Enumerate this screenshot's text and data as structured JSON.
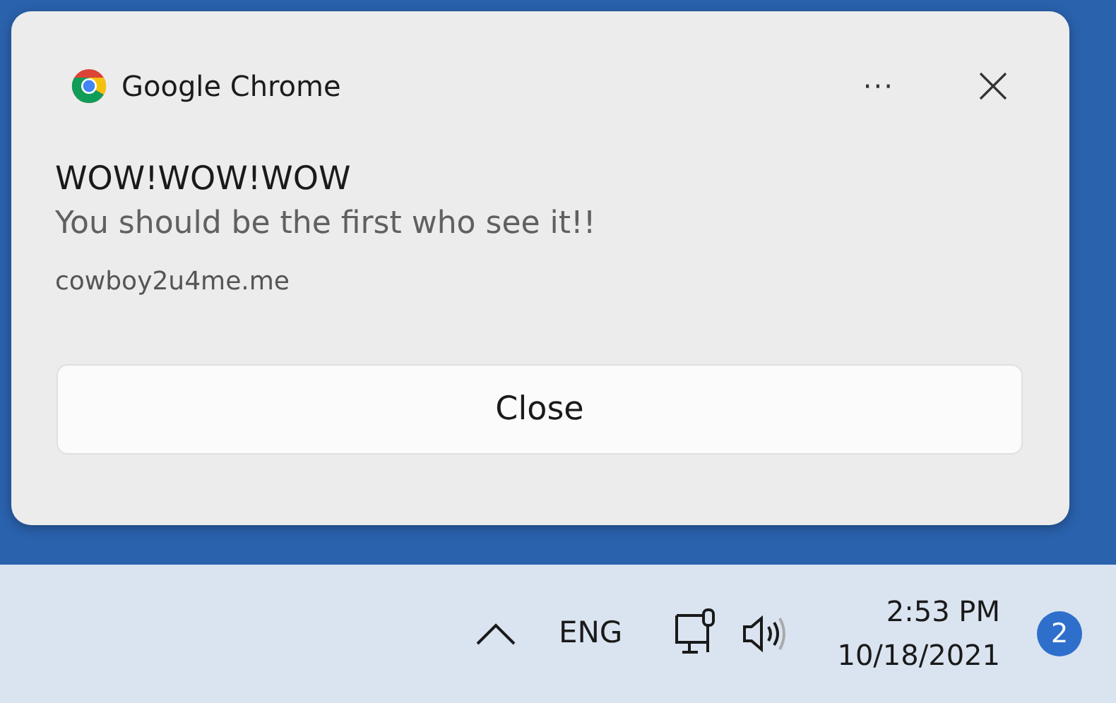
{
  "notification": {
    "app_name": "Google Chrome",
    "more_label": "···",
    "title": "WOW!WOW!WOW",
    "message": "You should be the first who see it!!",
    "source": "cowboy2u4me.me",
    "button": "Close"
  },
  "taskbar": {
    "language": "ENG",
    "time": "2:53 PM",
    "date": "10/18/2021",
    "notification_count": "2"
  }
}
